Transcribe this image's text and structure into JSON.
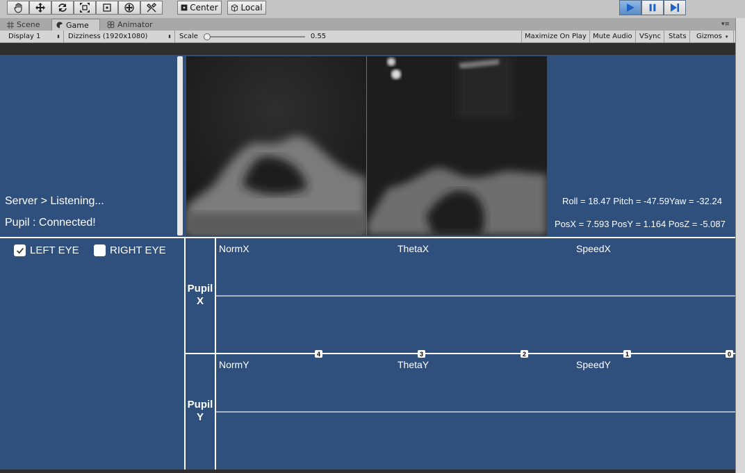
{
  "toolbar": {
    "pivot_label": "Center",
    "space_label": "Local"
  },
  "tabs": [
    {
      "label": "Scene",
      "icon": "grid-icon"
    },
    {
      "label": "Game",
      "icon": "pacman-icon"
    },
    {
      "label": "Animator",
      "icon": "animator-icon"
    }
  ],
  "gamebar": {
    "display": "Display 1",
    "resolution": "Dizziness (1920x1080)",
    "scale_label": "Scale",
    "scale_value": "0.55",
    "maximize": "Maximize On Play",
    "mute": "Mute Audio",
    "vsync": "VSync",
    "stats": "Stats",
    "gizmos": "Gizmos"
  },
  "status": {
    "server": "Server > Listening...",
    "pupil": "Pupil : Connected!"
  },
  "pose": {
    "rotation": "Roll = 18.47  Pitch = -47.59Yaw = -32.24",
    "position": "PosX = 7.593  PosY = 1.164  PosZ = -5.087"
  },
  "eyes": {
    "left_label": "LEFT EYE",
    "left_checked": true,
    "right_label": "RIGHT EYE",
    "right_checked": false
  },
  "graphs": {
    "x_row_label_1": "Pupil",
    "x_row_label_2": "X",
    "y_row_label_1": "Pupil",
    "y_row_label_2": "Y",
    "x_cols": [
      "NormX",
      "ThetaX",
      "SpeedX"
    ],
    "y_cols": [
      "NormY",
      "ThetaY",
      "SpeedY"
    ],
    "ticks": [
      "4",
      "3",
      "2",
      "1",
      "0"
    ]
  },
  "colors": {
    "game_bg": "#2f4f7d",
    "play_active": "#6fa0d8"
  }
}
